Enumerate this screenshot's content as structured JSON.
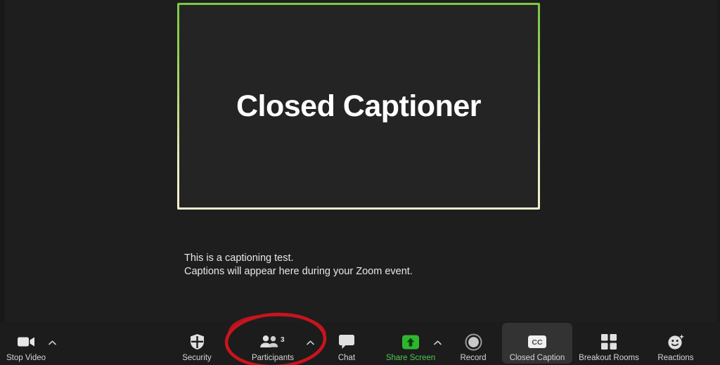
{
  "app": {
    "name": "Zoom Meeting",
    "background_color": "#1e1e1e",
    "toolbar_color": "#1c1c1c"
  },
  "stage": {
    "participant_name": "Closed Captioner",
    "border_gradient_from": "#7ac943",
    "border_gradient_to": "#f2f0cf",
    "tile_background": "#242424"
  },
  "captions": {
    "line1": "This is a captioning test.",
    "line2": "Captions will appear here during your Zoom event."
  },
  "toolbar": {
    "stop_video": {
      "label": "Stop Video",
      "icon": "video-camera-icon",
      "has_caret": true
    },
    "security": {
      "label": "Security",
      "icon": "shield-icon",
      "has_caret": false
    },
    "participants": {
      "label": "Participants",
      "icon": "people-icon",
      "count": "3",
      "has_caret": true
    },
    "chat": {
      "label": "Chat",
      "icon": "speech-bubble-icon",
      "has_caret": false
    },
    "share_screen": {
      "label": "Share Screen",
      "icon": "share-arrow-icon",
      "has_caret": true,
      "color": "#4ec94e"
    },
    "record": {
      "label": "Record",
      "icon": "record-circle-icon",
      "has_caret": false
    },
    "closed_caption": {
      "label": "Closed Caption",
      "icon": "cc-badge-icon",
      "badge_text": "CC",
      "active": true,
      "has_caret": false
    },
    "breakout_rooms": {
      "label": "Breakout Rooms",
      "icon": "grid-squares-icon",
      "has_caret": false
    },
    "reactions": {
      "label": "Reactions",
      "icon": "smiley-sparkle-icon",
      "has_caret": false
    }
  },
  "annotation": {
    "type": "ellipse-highlight",
    "color": "#c8141e",
    "target": "Participants"
  }
}
